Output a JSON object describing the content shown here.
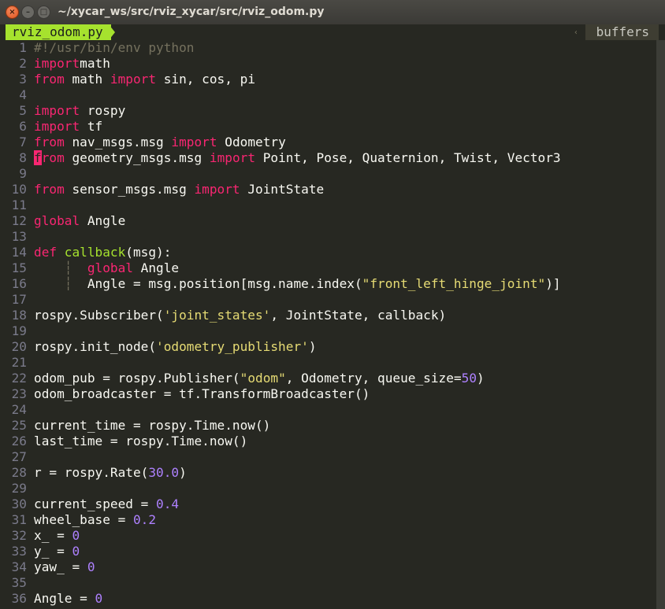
{
  "window": {
    "title": "~/xycar_ws/src/rviz_xycar/src/rviz_odom.py",
    "close_glyph": "×",
    "min_glyph": "–",
    "max_glyph": "□"
  },
  "editor": {
    "tab_label": "rviz_odom.py",
    "buffers_label": "buffers",
    "buffers_arrow": "‹"
  },
  "code_lines": [
    {
      "n": "1",
      "t": [
        [
          "cm",
          "#!/usr/bin/env python"
        ]
      ]
    },
    {
      "n": "2",
      "t": [
        [
          "kw",
          "import"
        ],
        [
          "",
          "math"
        ]
      ]
    },
    {
      "n": "3",
      "t": [
        [
          "kw",
          "from"
        ],
        [
          "",
          " math "
        ],
        [
          "kw",
          "import"
        ],
        [
          "",
          " sin, cos, pi"
        ]
      ]
    },
    {
      "n": "4",
      "t": []
    },
    {
      "n": "5",
      "t": [
        [
          "kw",
          "import"
        ],
        [
          "",
          " rospy"
        ]
      ]
    },
    {
      "n": "6",
      "t": [
        [
          "kw",
          "import"
        ],
        [
          "",
          " tf"
        ]
      ]
    },
    {
      "n": "7",
      "t": [
        [
          "kw",
          "from"
        ],
        [
          "",
          " nav_msgs.msg "
        ],
        [
          "kw",
          "import"
        ],
        [
          "",
          " Odometry"
        ]
      ]
    },
    {
      "n": "8",
      "t": [
        [
          "cur",
          "f"
        ],
        [
          "kw",
          "rom"
        ],
        [
          "",
          " geometry_msgs.msg "
        ],
        [
          "kw",
          "import"
        ],
        [
          "",
          " Point, Pose, Quaternion, Twist, Vector3"
        ]
      ]
    },
    {
      "n": "9",
      "t": []
    },
    {
      "n": "10",
      "t": [
        [
          "kw",
          "from"
        ],
        [
          "",
          " sensor_msgs.msg "
        ],
        [
          "kw",
          "import"
        ],
        [
          "",
          " JointState"
        ]
      ]
    },
    {
      "n": "11",
      "t": []
    },
    {
      "n": "12",
      "t": [
        [
          "kw",
          "global"
        ],
        [
          "",
          " Angle"
        ]
      ]
    },
    {
      "n": "13",
      "t": []
    },
    {
      "n": "14",
      "t": [
        [
          "kw",
          "def"
        ],
        [
          "",
          " "
        ],
        [
          "fn",
          "callback"
        ],
        [
          "",
          "(msg):"
        ]
      ]
    },
    {
      "n": "15",
      "t": [
        [
          "cm",
          "    ┆  "
        ],
        [
          "kw",
          "global"
        ],
        [
          "",
          " Angle"
        ]
      ]
    },
    {
      "n": "16",
      "t": [
        [
          "cm",
          "    ┆  "
        ],
        [
          "",
          "Angle = msg.position[msg.name.index("
        ],
        [
          "st",
          "\"front_left_hinge_joint\""
        ],
        [
          "",
          ")]"
        ]
      ]
    },
    {
      "n": "17",
      "t": []
    },
    {
      "n": "18",
      "t": [
        [
          "",
          "rospy.Subscriber("
        ],
        [
          "st",
          "'joint_states'"
        ],
        [
          "",
          ", JointState, callback)"
        ]
      ]
    },
    {
      "n": "19",
      "t": []
    },
    {
      "n": "20",
      "t": [
        [
          "",
          "rospy.init_node("
        ],
        [
          "st",
          "'odometry_publisher'"
        ],
        [
          "",
          ")"
        ]
      ]
    },
    {
      "n": "21",
      "t": []
    },
    {
      "n": "22",
      "t": [
        [
          "",
          "odom_pub = rospy.Publisher("
        ],
        [
          "st",
          "\"odom\""
        ],
        [
          "",
          ", Odometry, queue_size="
        ],
        [
          "nm",
          "50"
        ],
        [
          "",
          ")"
        ]
      ]
    },
    {
      "n": "23",
      "t": [
        [
          "",
          "odom_broadcaster = tf.TransformBroadcaster()"
        ]
      ]
    },
    {
      "n": "24",
      "t": []
    },
    {
      "n": "25",
      "t": [
        [
          "",
          "current_time = rospy.Time.now()"
        ]
      ]
    },
    {
      "n": "26",
      "t": [
        [
          "",
          "last_time = rospy.Time.now()"
        ]
      ]
    },
    {
      "n": "27",
      "t": []
    },
    {
      "n": "28",
      "t": [
        [
          "",
          "r = rospy.Rate("
        ],
        [
          "nm",
          "30.0"
        ],
        [
          "",
          ")"
        ]
      ]
    },
    {
      "n": "29",
      "t": []
    },
    {
      "n": "30",
      "t": [
        [
          "",
          "current_speed = "
        ],
        [
          "nm",
          "0.4"
        ]
      ]
    },
    {
      "n": "31",
      "t": [
        [
          "",
          "wheel_base = "
        ],
        [
          "nm",
          "0.2"
        ]
      ]
    },
    {
      "n": "32",
      "t": [
        [
          "",
          "x_ = "
        ],
        [
          "nm",
          "0"
        ]
      ]
    },
    {
      "n": "33",
      "t": [
        [
          "",
          "y_ = "
        ],
        [
          "nm",
          "0"
        ]
      ]
    },
    {
      "n": "34",
      "t": [
        [
          "",
          "yaw_ = "
        ],
        [
          "nm",
          "0"
        ]
      ]
    },
    {
      "n": "35",
      "t": []
    },
    {
      "n": "36",
      "t": [
        [
          "",
          "Angle = "
        ],
        [
          "nm",
          "0"
        ]
      ]
    }
  ]
}
